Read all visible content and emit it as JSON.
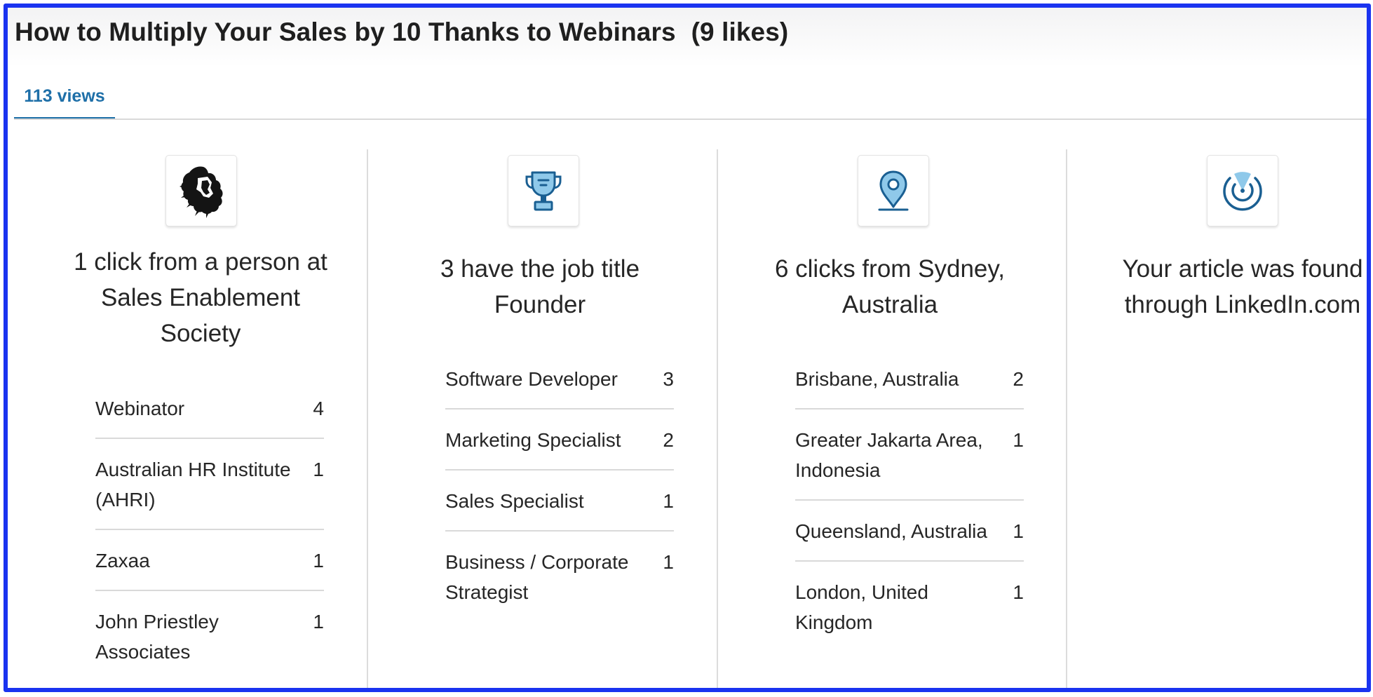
{
  "article": {
    "title": "How to Multiply Your Sales by 10 Thanks to Webinars",
    "likes": "(9 likes)"
  },
  "tab": {
    "label": "113 views"
  },
  "colors": {
    "accent": "#1e6fa8",
    "frame": "#1a33f0",
    "icon": "#1a5f92",
    "icon_fill": "#8fc9ea"
  },
  "columns": [
    {
      "icon": "lion-logo-icon",
      "headline": "1 click from a person at Sales Enablement Society",
      "items": [
        {
          "name": "Webinator",
          "count": "4"
        },
        {
          "name": "Australian HR Institute (AHRI)",
          "count": "1"
        },
        {
          "name": "Zaxaa",
          "count": "1"
        },
        {
          "name": "John Priestley Associates",
          "count": "1"
        }
      ]
    },
    {
      "icon": "trophy-icon",
      "headline": "3 have the job title Founder",
      "items": [
        {
          "name": "Software Developer",
          "count": "3"
        },
        {
          "name": "Marketing Specialist",
          "count": "2"
        },
        {
          "name": "Sales Specialist",
          "count": "1"
        },
        {
          "name": "Business / Corporate Strategist",
          "count": "1"
        }
      ]
    },
    {
      "icon": "location-pin-icon",
      "headline": "6 clicks from Sydney, Australia",
      "items": [
        {
          "name": "Brisbane, Australia",
          "count": "2"
        },
        {
          "name": "Greater Jakarta Area, Indonesia",
          "count": "1"
        },
        {
          "name": "Queensland, Australia",
          "count": "1"
        },
        {
          "name": "London, United Kingdom",
          "count": "1"
        }
      ]
    },
    {
      "icon": "radar-icon",
      "headline": "Your article was found through LinkedIn.com"
    }
  ]
}
